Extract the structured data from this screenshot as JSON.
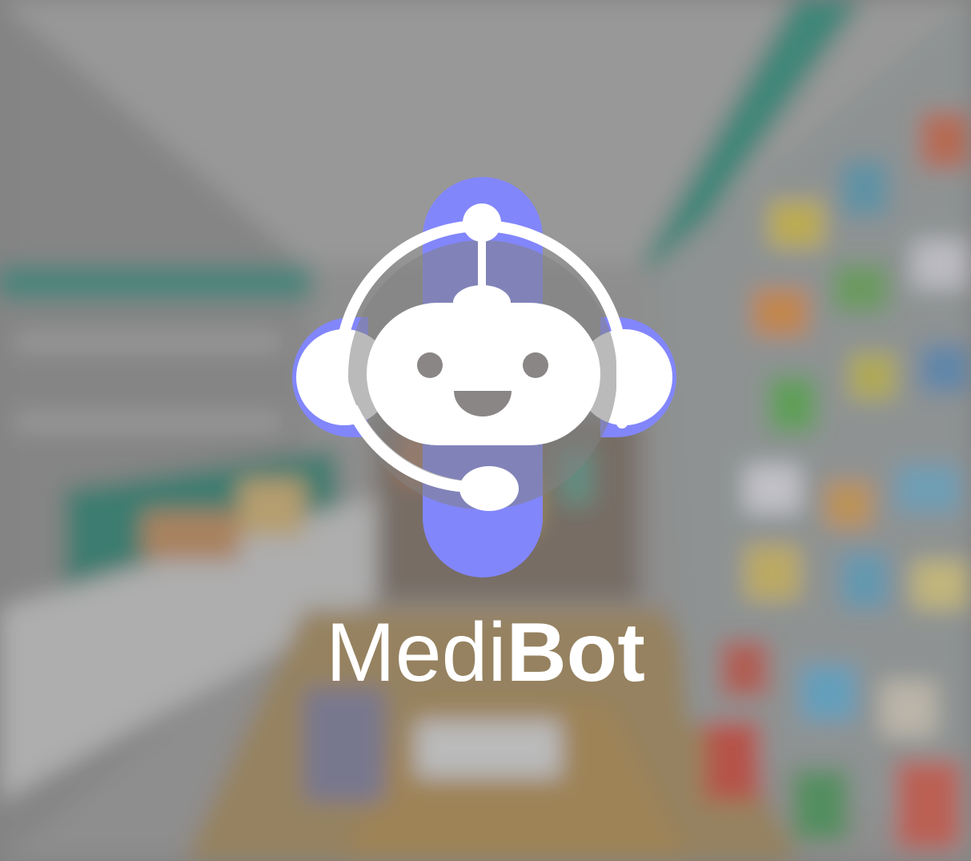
{
  "app": {
    "brand_light": "Medi",
    "brand_bold": "Bot"
  },
  "logo": {
    "icon": "robot-headset-icon",
    "accent_color": "#8286fb",
    "foreground_color": "#ffffff"
  },
  "background": {
    "description_icon": "blurred-pharmacy-background",
    "teal_color": "#2e8f7e"
  }
}
